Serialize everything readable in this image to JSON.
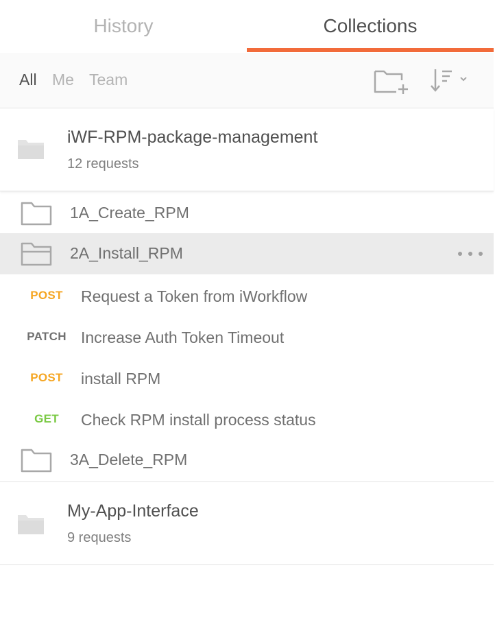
{
  "tabs": {
    "history": "History",
    "collections": "Collections",
    "active": "Collections"
  },
  "filters": {
    "all": "All",
    "me": "Me",
    "team": "Team",
    "selected": "All"
  },
  "toolbar": {
    "new_collection_icon": "folder-plus-icon",
    "sort_icon": "sort-descending-icon"
  },
  "collections": [
    {
      "name": "iWF-RPM-package-management",
      "count": "12 requests",
      "expanded": true,
      "folders": [
        {
          "name": "1A_Create_RPM",
          "open": false
        },
        {
          "name": "2A_Install_RPM",
          "open": true,
          "requests": [
            {
              "method": "POST",
              "name": "Request a Token from iWorkflow"
            },
            {
              "method": "PATCH",
              "name": "Increase Auth Token Timeout"
            },
            {
              "method": "POST",
              "name": "install RPM"
            },
            {
              "method": "GET",
              "name": "Check RPM install process status"
            }
          ]
        },
        {
          "name": "3A_Delete_RPM",
          "open": false
        }
      ]
    },
    {
      "name": "My-App-Interface",
      "count": "9 requests",
      "expanded": false
    }
  ],
  "colors": {
    "accent": "#f26b3a",
    "post": "#f5a623",
    "get": "#7ac943",
    "patch": "#707070"
  }
}
